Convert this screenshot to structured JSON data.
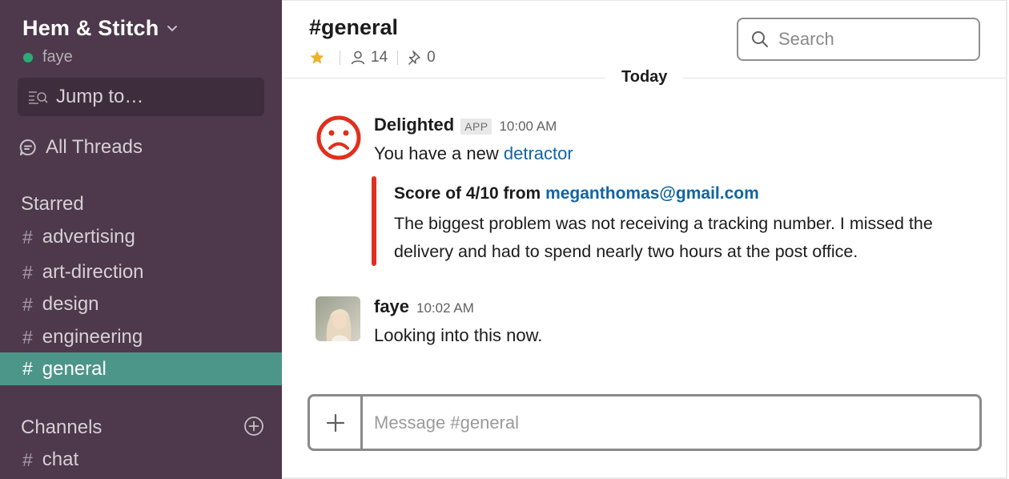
{
  "sidebar": {
    "team_name": "Hem & Stitch",
    "user_name": "faye",
    "jump_label": "Jump to…",
    "all_threads_label": "All Threads",
    "starred_title": "Starred",
    "starred_channels": [
      {
        "hash": "#",
        "name": "advertising"
      },
      {
        "hash": "#",
        "name": "art-direction"
      },
      {
        "hash": "#",
        "name": "design"
      },
      {
        "hash": "#",
        "name": "engineering"
      },
      {
        "hash": "#",
        "name": "general"
      }
    ],
    "channels_title": "Channels",
    "channels": [
      {
        "hash": "#",
        "name": "chat"
      }
    ],
    "colors": {
      "background": "#4d394b",
      "active": "#4c9689",
      "presence": "#2bac76"
    }
  },
  "header": {
    "channel_name": "#general",
    "member_count": "14",
    "pinned_count": "0",
    "search_placeholder": "Search"
  },
  "feed": {
    "day_label": "Today",
    "messages": [
      {
        "sender": "Delighted",
        "badge": "APP",
        "time": "10:00 AM",
        "text_prefix": "You have a new ",
        "text_link": "detractor",
        "attachment": {
          "title_prefix": "Score of 4/10 from ",
          "email": "meganthomas@gmail.com",
          "body": "The biggest problem was not receiving a tracking number. I missed the delivery and had to spend nearly two hours at the post office.",
          "bar_color": "#e0301e"
        },
        "avatar_icon": "sad-face-icon"
      },
      {
        "sender": "faye",
        "time": "10:02 AM",
        "text": "Looking into this now.",
        "avatar_icon": "user-photo"
      }
    ]
  },
  "composer": {
    "placeholder": "Message #general",
    "plus_icon": "plus-icon"
  }
}
